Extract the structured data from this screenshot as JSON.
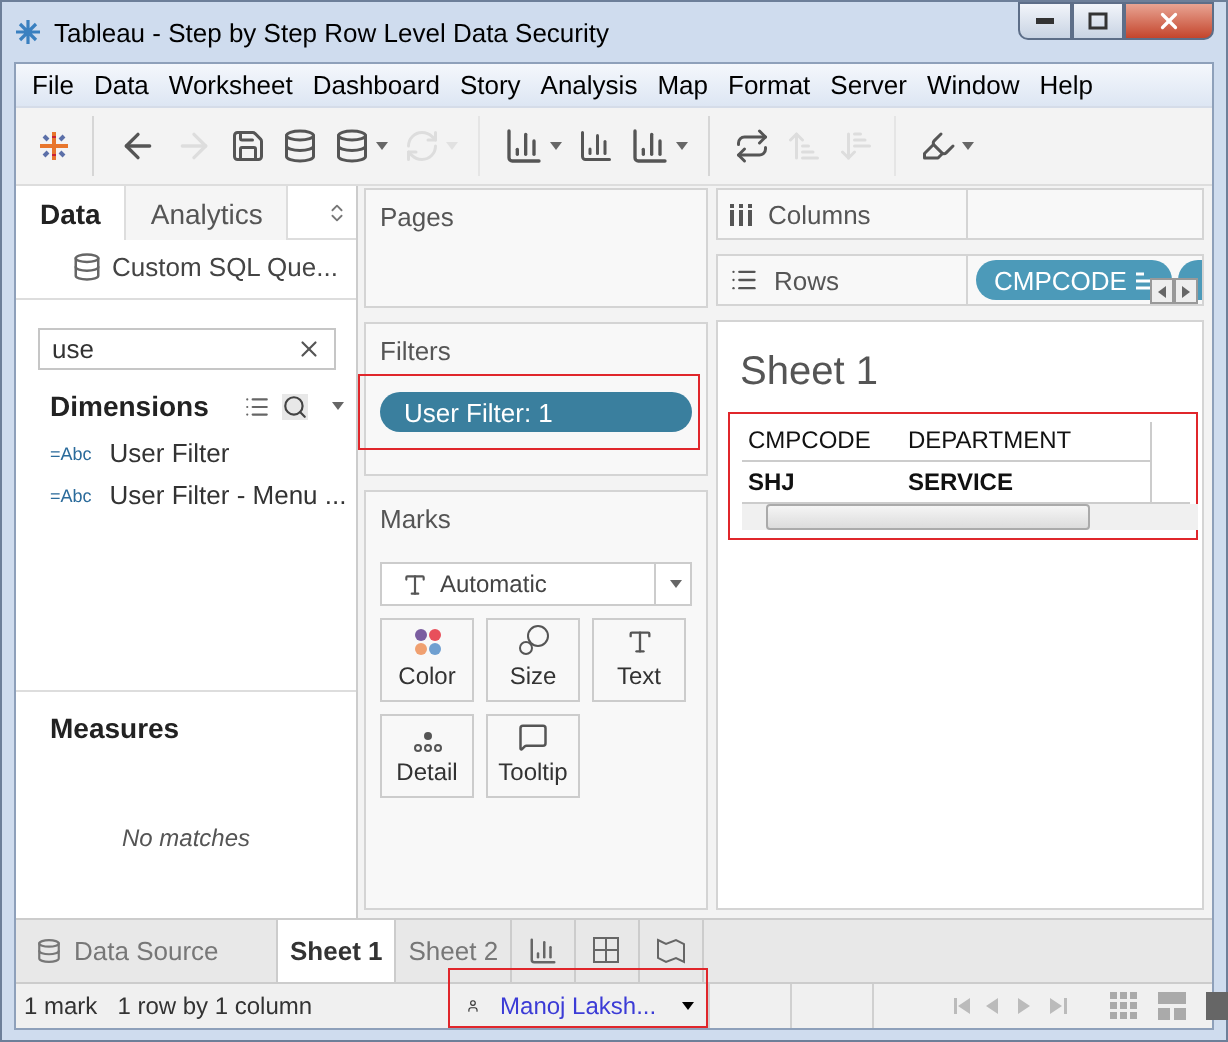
{
  "window": {
    "title": "Tableau - Step by Step Row Level Data Security"
  },
  "menu": [
    "File",
    "Data",
    "Worksheet",
    "Dashboard",
    "Story",
    "Analysis",
    "Map",
    "Format",
    "Server",
    "Window",
    "Help"
  ],
  "toolbar": [
    {
      "kind": "logo",
      "disabled": false,
      "dropdown": false,
      "separator_after": true
    },
    {
      "kind": "back",
      "disabled": false,
      "dropdown": false,
      "separator_after": false
    },
    {
      "kind": "forward",
      "disabled": true,
      "dropdown": false,
      "separator_after": false
    },
    {
      "kind": "save",
      "disabled": false,
      "dropdown": false,
      "separator_after": false
    },
    {
      "kind": "new-datasource",
      "disabled": false,
      "dropdown": false,
      "separator_after": false
    },
    {
      "kind": "pause",
      "disabled": false,
      "dropdown": true,
      "separator_after": false
    },
    {
      "kind": "refresh",
      "disabled": true,
      "dropdown": true,
      "separator_after": true
    },
    {
      "kind": "new-sheet",
      "disabled": false,
      "dropdown": true,
      "separator_after": false
    },
    {
      "kind": "duplicate",
      "disabled": false,
      "dropdown": false,
      "separator_after": false
    },
    {
      "kind": "clear",
      "disabled": false,
      "dropdown": true,
      "separator_after": true
    },
    {
      "kind": "swap",
      "disabled": false,
      "dropdown": false,
      "separator_after": false
    },
    {
      "kind": "sort-asc",
      "disabled": true,
      "dropdown": false,
      "separator_after": false
    },
    {
      "kind": "sort-desc",
      "disabled": true,
      "dropdown": false,
      "separator_after": true
    },
    {
      "kind": "highlight",
      "disabled": false,
      "dropdown": true,
      "separator_after": false
    }
  ],
  "data_pane": {
    "tabs": [
      {
        "label": "Data",
        "selected": true
      },
      {
        "label": "Analytics",
        "selected": false
      }
    ],
    "datasource": "Custom SQL Que...",
    "search": {
      "value": "use"
    },
    "dimensions": {
      "title": "Dimensions",
      "fields": [
        {
          "type": "=Abc",
          "name": "User Filter"
        },
        {
          "type": "=Abc",
          "name": "User Filter - Menu ..."
        }
      ]
    },
    "measures": {
      "title": "Measures",
      "empty": "No matches"
    }
  },
  "pages": {
    "title": "Pages"
  },
  "filters": {
    "title": "Filters",
    "pills": [
      {
        "label": "User Filter: 1",
        "highlighted": true
      }
    ]
  },
  "marks": {
    "title": "Marks",
    "type": "Automatic",
    "cards": [
      {
        "kind": "color",
        "label": "Color"
      },
      {
        "kind": "size",
        "label": "Size"
      },
      {
        "kind": "text",
        "label": "Text"
      },
      {
        "kind": "detail",
        "label": "Detail"
      },
      {
        "kind": "tooltip",
        "label": "Tooltip"
      }
    ]
  },
  "columns_shelf": {
    "title": "Columns"
  },
  "rows_shelf": {
    "title": "Rows",
    "pills": [
      {
        "label": "CMPCODE"
      }
    ]
  },
  "sheet": {
    "title": "Sheet 1",
    "highlighted": true,
    "columns": [
      "CMPCODE",
      "DEPARTMENT"
    ],
    "rows": [
      [
        "SHJ",
        "SERVICE"
      ]
    ]
  },
  "sheet_tabs": {
    "data_source": "Data Source",
    "tabs": [
      {
        "label": "Sheet 1",
        "selected": true
      },
      {
        "label": "Sheet 2",
        "selected": false
      }
    ]
  },
  "status_bar": {
    "marks": "1 mark",
    "size": "1 row by 1 column",
    "user": {
      "name": "Manoj Laksh...",
      "highlighted": true
    }
  }
}
